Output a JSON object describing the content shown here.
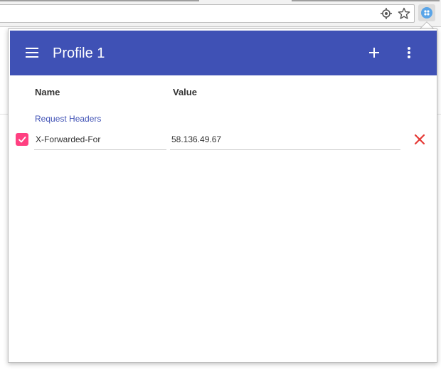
{
  "profile": {
    "title": "Profile 1"
  },
  "columns": {
    "name": "Name",
    "value": "Value"
  },
  "section": {
    "label": "Request Headers"
  },
  "headers": [
    {
      "enabled": true,
      "name": "X-Forwarded-For",
      "value": "58.136.49.67"
    }
  ],
  "icons": {
    "menu": "menu-icon",
    "add": "plus-icon",
    "more": "more-vert-icon",
    "delete": "close-icon",
    "location": "location-target-icon",
    "bookmark": "star-icon",
    "extension": "extension-badge-icon"
  },
  "colors": {
    "toolbar": "#3f51b5",
    "checkbox": "#ff4081",
    "delete": "#e53935",
    "section_label": "#3f51b5"
  }
}
